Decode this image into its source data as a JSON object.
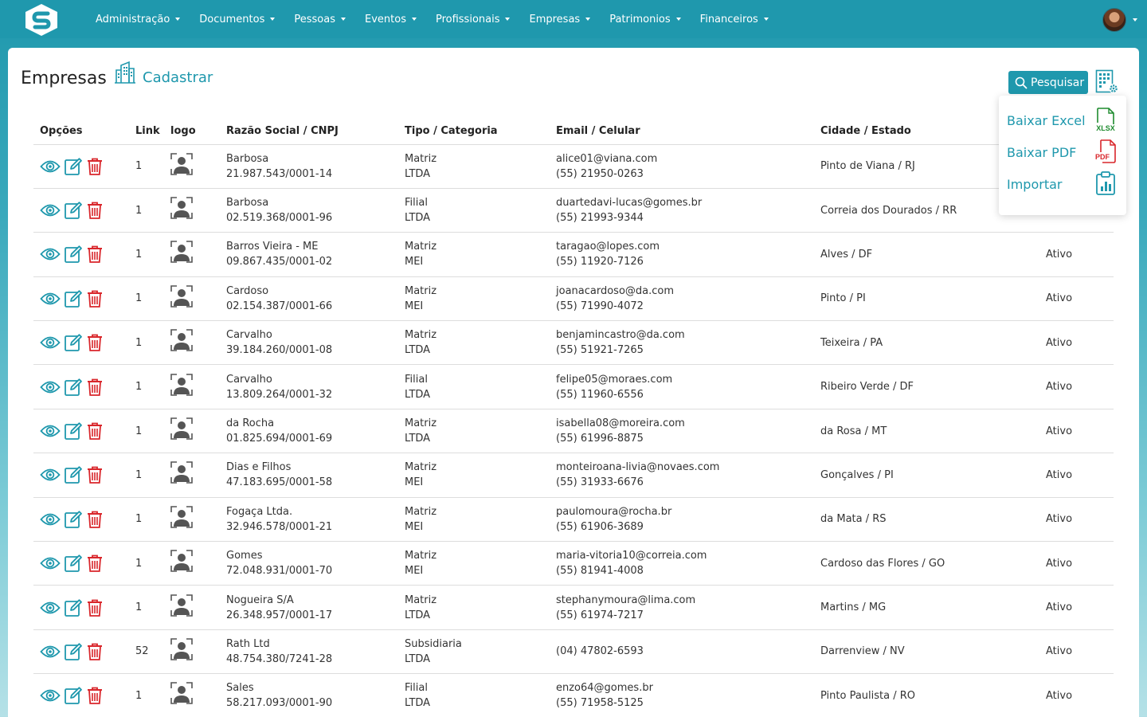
{
  "nav": {
    "items": [
      "Administração",
      "Documentos",
      "Pessoas",
      "Eventos",
      "Profissionais",
      "Empresas",
      "Patrimonios",
      "Financeiros"
    ]
  },
  "page": {
    "title": "Empresas",
    "register_label": "Cadastrar",
    "search_label": "Pesquisar"
  },
  "dropdown": {
    "excel": "Baixar Excel",
    "pdf": "Baixar PDF",
    "import": "Importar",
    "xlsx_tag": "XLSX",
    "pdf_tag": "PDF"
  },
  "table": {
    "headers": [
      "Opções",
      "Link",
      "logo",
      "Razão Social / CNPJ",
      "Tipo / Categoria",
      "Email / Celular",
      "Cidade / Estado",
      ""
    ],
    "rows": [
      {
        "link": "1",
        "name": "Barbosa",
        "cnpj": "21.987.543/0001-14",
        "tipo": "Matriz",
        "cat": "LTDA",
        "email": "alice01@viana.com",
        "phone": "(55) 21950-0263",
        "city": "Pinto de Viana / RJ",
        "status": ""
      },
      {
        "link": "1",
        "name": "Barbosa",
        "cnpj": "02.519.368/0001-96",
        "tipo": "Filial",
        "cat": "LTDA",
        "email": "duartedavi-lucas@gomes.br",
        "phone": "(55) 21993-9344",
        "city": "Correia dos Dourados / RR",
        "status": ""
      },
      {
        "link": "1",
        "name": "Barros Vieira - ME",
        "cnpj": "09.867.435/0001-02",
        "tipo": "Matriz",
        "cat": "MEI",
        "email": "taragao@lopes.com",
        "phone": "(55) 11920-7126",
        "city": "Alves / DF",
        "status": "Ativo"
      },
      {
        "link": "1",
        "name": "Cardoso",
        "cnpj": "02.154.387/0001-66",
        "tipo": "Matriz",
        "cat": "MEI",
        "email": "joanacardoso@da.com",
        "phone": "(55) 71990-4072",
        "city": "Pinto / PI",
        "status": "Ativo"
      },
      {
        "link": "1",
        "name": "Carvalho",
        "cnpj": "39.184.260/0001-08",
        "tipo": "Matriz",
        "cat": "LTDA",
        "email": "benjamincastro@da.com",
        "phone": "(55) 51921-7265",
        "city": "Teixeira / PA",
        "status": "Ativo"
      },
      {
        "link": "1",
        "name": "Carvalho",
        "cnpj": "13.809.264/0001-32",
        "tipo": "Filial",
        "cat": "LTDA",
        "email": "felipe05@moraes.com",
        "phone": "(55) 11960-6556",
        "city": "Ribeiro Verde / DF",
        "status": "Ativo"
      },
      {
        "link": "1",
        "name": "da Rocha",
        "cnpj": "01.825.694/0001-69",
        "tipo": "Matriz",
        "cat": "LTDA",
        "email": "isabella08@moreira.com",
        "phone": "(55) 61996-8875",
        "city": "da Rosa / MT",
        "status": "Ativo"
      },
      {
        "link": "1",
        "name": "Dias e Filhos",
        "cnpj": "47.183.695/0001-58",
        "tipo": "Matriz",
        "cat": "MEI",
        "email": "monteiroana-livia@novaes.com",
        "phone": "(55) 31933-6676",
        "city": "Gonçalves / PI",
        "status": "Ativo"
      },
      {
        "link": "1",
        "name": "Fogaça Ltda.",
        "cnpj": "32.946.578/0001-21",
        "tipo": "Matriz",
        "cat": "MEI",
        "email": "paulomoura@rocha.br",
        "phone": "(55) 61906-3689",
        "city": "da Mata / RS",
        "status": "Ativo"
      },
      {
        "link": "1",
        "name": "Gomes",
        "cnpj": "72.048.931/0001-70",
        "tipo": "Matriz",
        "cat": "MEI",
        "email": "maria-vitoria10@correia.com",
        "phone": "(55) 81941-4008",
        "city": "Cardoso das Flores / GO",
        "status": "Ativo"
      },
      {
        "link": "1",
        "name": "Nogueira S/A",
        "cnpj": "26.348.957/0001-17",
        "tipo": "Matriz",
        "cat": "LTDA",
        "email": "stephanymoura@lima.com",
        "phone": "(55) 61974-7217",
        "city": "Martins / MG",
        "status": "Ativo"
      },
      {
        "link": "52",
        "name": "Rath Ltd",
        "cnpj": "48.754.380/7241-28",
        "tipo": "Subsidiaria",
        "cat": "LTDA",
        "email": "",
        "phone": "(04) 47802-6593",
        "city": "Darrenview / NV",
        "status": "Ativo"
      },
      {
        "link": "1",
        "name": "Sales",
        "cnpj": "58.217.093/0001-90",
        "tipo": "Filial",
        "cat": "LTDA",
        "email": "enzo64@gomes.br",
        "phone": "(55) 71958-5125",
        "city": "Pinto Paulista / RO",
        "status": "Ativo"
      }
    ]
  },
  "colors": {
    "brand": "#1f98ad",
    "delete": "#d9262b",
    "xlsx": "#1e8b2e",
    "pdf": "#d9262b"
  }
}
